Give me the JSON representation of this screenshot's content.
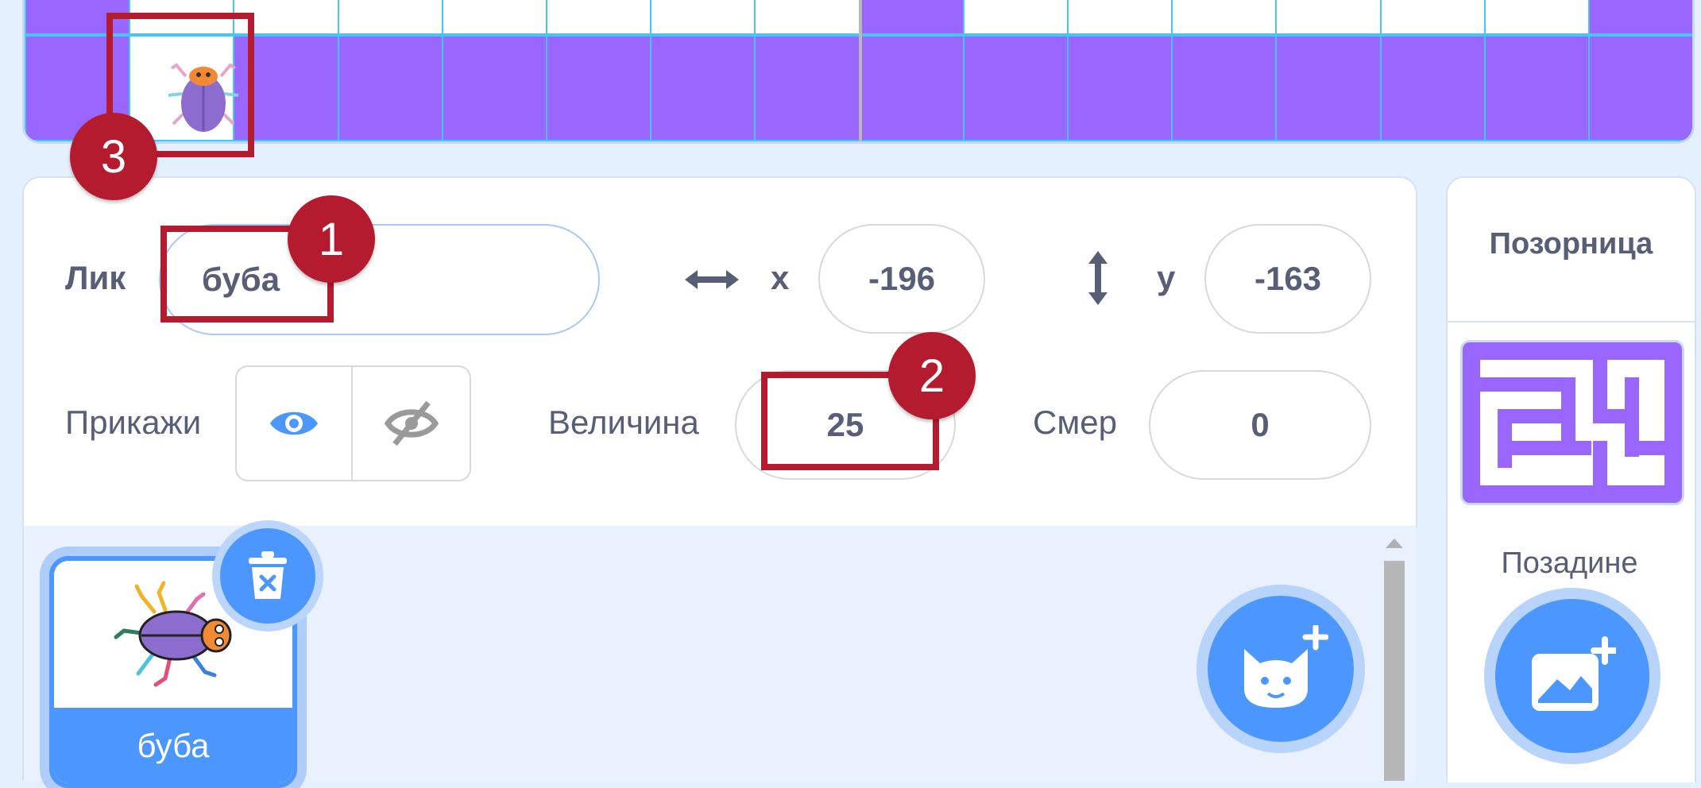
{
  "sprite_info": {
    "sprite_label": "Лик",
    "sprite_name": "буба",
    "x_label": "x",
    "x_value": "-196",
    "y_label": "y",
    "y_value": "-163",
    "show_label": "Прикажи",
    "size_label": "Величина",
    "size_value": "25",
    "direction_label": "Смер",
    "direction_value": "0"
  },
  "sprite_list": {
    "items": [
      {
        "name": "буба",
        "selected": true
      }
    ]
  },
  "stage_panel": {
    "title": "Позорница",
    "backdrops_label": "Позадине"
  },
  "annotations": [
    "1",
    "2",
    "3"
  ],
  "colors": {
    "accent": "#4c97ff",
    "stage_purple": "#9966ff",
    "annotation_red": "#b41b2e",
    "text": "#575e75"
  },
  "icons": {
    "x_axis": "horizontal-arrows-icon",
    "y_axis": "vertical-arrows-icon",
    "show": "eye-icon",
    "hide": "eye-slash-icon",
    "delete": "trash-icon",
    "add_sprite": "cat-plus-icon",
    "add_backdrop": "image-plus-icon"
  }
}
